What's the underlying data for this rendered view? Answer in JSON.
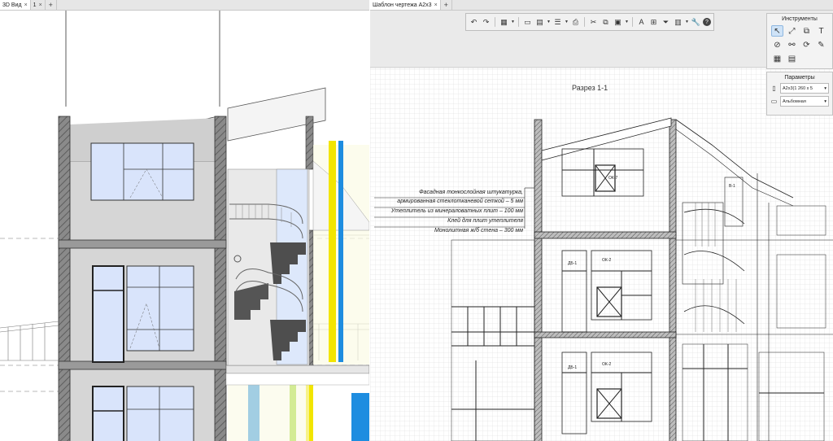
{
  "tabs": {
    "left": [
      {
        "label": "3D Вид",
        "close": "×"
      },
      {
        "label": "1",
        "close": "×"
      },
      {
        "label": "+"
      }
    ],
    "right": [
      {
        "label": "Шаблон чертежа А2х3",
        "close": "×"
      },
      {
        "label": "+"
      }
    ]
  },
  "toolbar": {
    "icons": [
      "undo-icon",
      "redo-icon",
      "layers-icon",
      "print-preview-icon",
      "sheet-icon",
      "properties-icon",
      "print-icon",
      "cut-icon",
      "copy-icon",
      "paste-icon",
      "text-style-icon",
      "tag-icon",
      "filter-icon",
      "table-icon",
      "wrench-icon",
      "help-icon"
    ]
  },
  "instruments": {
    "title": "Инструменты",
    "tools": [
      "cursor-tool-icon",
      "dimension-tool-icon",
      "view-tool-icon",
      "text-tool-icon",
      "detail-tool-icon",
      "link-tool-icon",
      "rotate-tool-icon",
      "note-tool-icon",
      "grid-tool-icon",
      "table-tool-icon"
    ]
  },
  "parameters": {
    "title": "Параметры",
    "format": "А2х3(1 260 x 5",
    "orientation": "Альбомная"
  },
  "drawing": {
    "section_title": "Разрез 1-1",
    "callout_lines": [
      "Фасадная тонкослойная штукатурка,",
      "армированная стеклотканевой сеткой – 5 мм",
      "Утеплитель из минераловатных плит – 100 мм",
      "Клей для плит утеплителя",
      "Монолитная ж/б стена – 300 мм"
    ],
    "window_tags": {
      "top": "ОК-7",
      "mid_door": "ДБ-1",
      "mid_window": "ОК-2",
      "low_door": "ДБ-1",
      "low_window": "ОК-2",
      "stair_tag": "В-1"
    }
  }
}
